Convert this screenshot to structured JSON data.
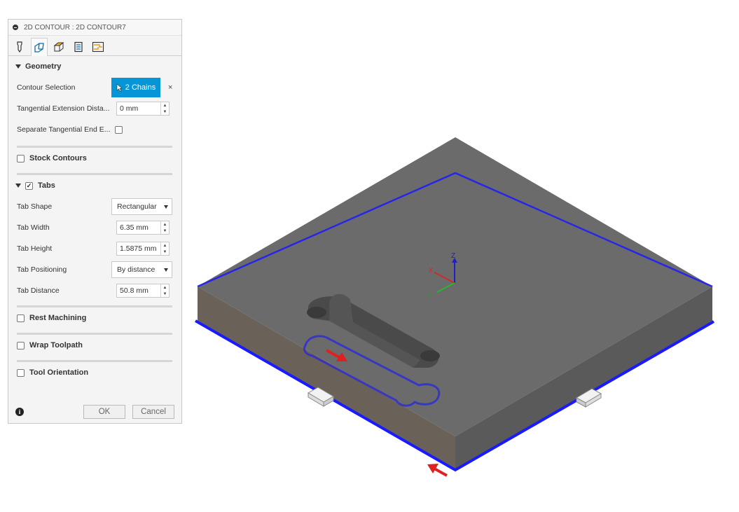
{
  "panel": {
    "title": "2D CONTOUR : 2D CONTOUR7",
    "tab_icons": [
      "tool-icon",
      "geometry-icon",
      "heights-icon",
      "passes-icon",
      "linking-icon"
    ],
    "geometry": {
      "header": "Geometry",
      "contour_selection_label": "Contour Selection",
      "contour_selection_button": "2 Chains",
      "clear_icon": "×",
      "tangential_extension_label": "Tangential Extension Dista...",
      "tangential_extension_value": "0 mm",
      "separate_tangential_label": "Separate Tangential End E...",
      "separate_tangential_checked": false
    },
    "stock_contours": {
      "header": "Stock Contours",
      "checked": false
    },
    "tabs": {
      "header": "Tabs",
      "checked": true,
      "check_glyph": "✓",
      "tab_shape_label": "Tab Shape",
      "tab_shape_value": "Rectangular",
      "tab_width_label": "Tab Width",
      "tab_width_value": "6.35 mm",
      "tab_height_label": "Tab Height",
      "tab_height_value": "1.5875 mm",
      "tab_positioning_label": "Tab Positioning",
      "tab_positioning_value": "By distance",
      "tab_distance_label": "Tab Distance",
      "tab_distance_value": "50.8 mm"
    },
    "rest_machining": {
      "header": "Rest Machining",
      "checked": false
    },
    "wrap_toolpath": {
      "header": "Wrap Toolpath",
      "checked": false
    },
    "tool_orientation": {
      "header": "Tool Orientation",
      "checked": false
    },
    "footer": {
      "info_icon": "i",
      "ok_label": "OK",
      "cancel_label": "Cancel"
    }
  },
  "viewport": {
    "axes": {
      "x": "X",
      "y": "Y",
      "z": "Z"
    },
    "colors": {
      "part_top": "#6b6b6b",
      "part_side": "#6a6158",
      "contour": "#1a1aff",
      "arrow": "#e02020"
    }
  }
}
